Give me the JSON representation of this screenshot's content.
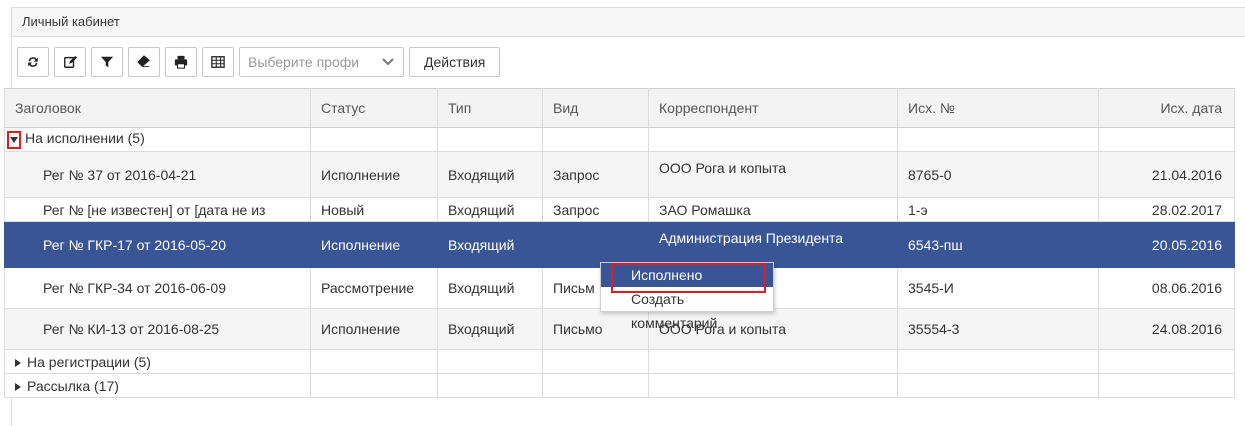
{
  "panel": {
    "title": "Личный кабинет"
  },
  "toolbar": {
    "buttons": [
      {
        "icon": "refresh-icon"
      },
      {
        "icon": "edit-icon"
      },
      {
        "icon": "filter-icon"
      },
      {
        "icon": "eraser-icon"
      },
      {
        "icon": "print-icon"
      },
      {
        "icon": "table-icon"
      }
    ],
    "profile_placeholder": "Выберите профи",
    "actions_label": "Действия"
  },
  "grid": {
    "columns": [
      "Заголовок",
      "Статус",
      "Тип",
      "Вид",
      "Корреспондент",
      "Исх. №",
      "Исх. дата"
    ],
    "groups": [
      {
        "label": "На исполнении (5)",
        "expanded": true,
        "rows": [
          {
            "title": "Рег № 37 от 2016-04-21",
            "status": "Исполнение",
            "type": "Входящий",
            "kind": "Запрос",
            "correspondent": "ООО Рога и копыта",
            "out_no": "8765-0",
            "out_date": "21.04.2016"
          },
          {
            "title": "Рег № [не известен] от [дата не из",
            "status": "Новый",
            "type": "Входящий",
            "kind": "Запрос",
            "correspondent": "ЗАО Ромашка",
            "out_no": "1-э",
            "out_date": "28.02.2017"
          },
          {
            "title": "Рег № ГКР-17 от 2016-05-20",
            "status": "Исполнение",
            "type": "Входящий",
            "kind": "",
            "correspondent": "Администрация Президента",
            "out_no": "6543-пш",
            "out_date": "20.05.2016",
            "selected": true
          },
          {
            "title": "Рег № ГКР-34 от 2016-06-09",
            "status": "Рассмотрение",
            "type": "Входящий",
            "kind": "Письм",
            "correspondent": "",
            "out_no": "3545-И",
            "out_date": "08.06.2016"
          },
          {
            "title": "Рег № КИ-13 от 2016-08-25",
            "status": "Исполнение",
            "type": "Входящий",
            "kind": "Письмо",
            "correspondent": "ООО Рога и копыта",
            "out_no": "35554-3",
            "out_date": "24.08.2016"
          }
        ]
      },
      {
        "label": "На регистрации (5)",
        "expanded": false
      },
      {
        "label": "Рассылка (17)",
        "expanded": false
      }
    ]
  },
  "context_menu": {
    "items": [
      "Исполнено",
      "Создать комментарий"
    ],
    "highlighted_index": 0
  },
  "colors": {
    "selection": "#3a5595",
    "highlight_box": "#e01b24"
  }
}
